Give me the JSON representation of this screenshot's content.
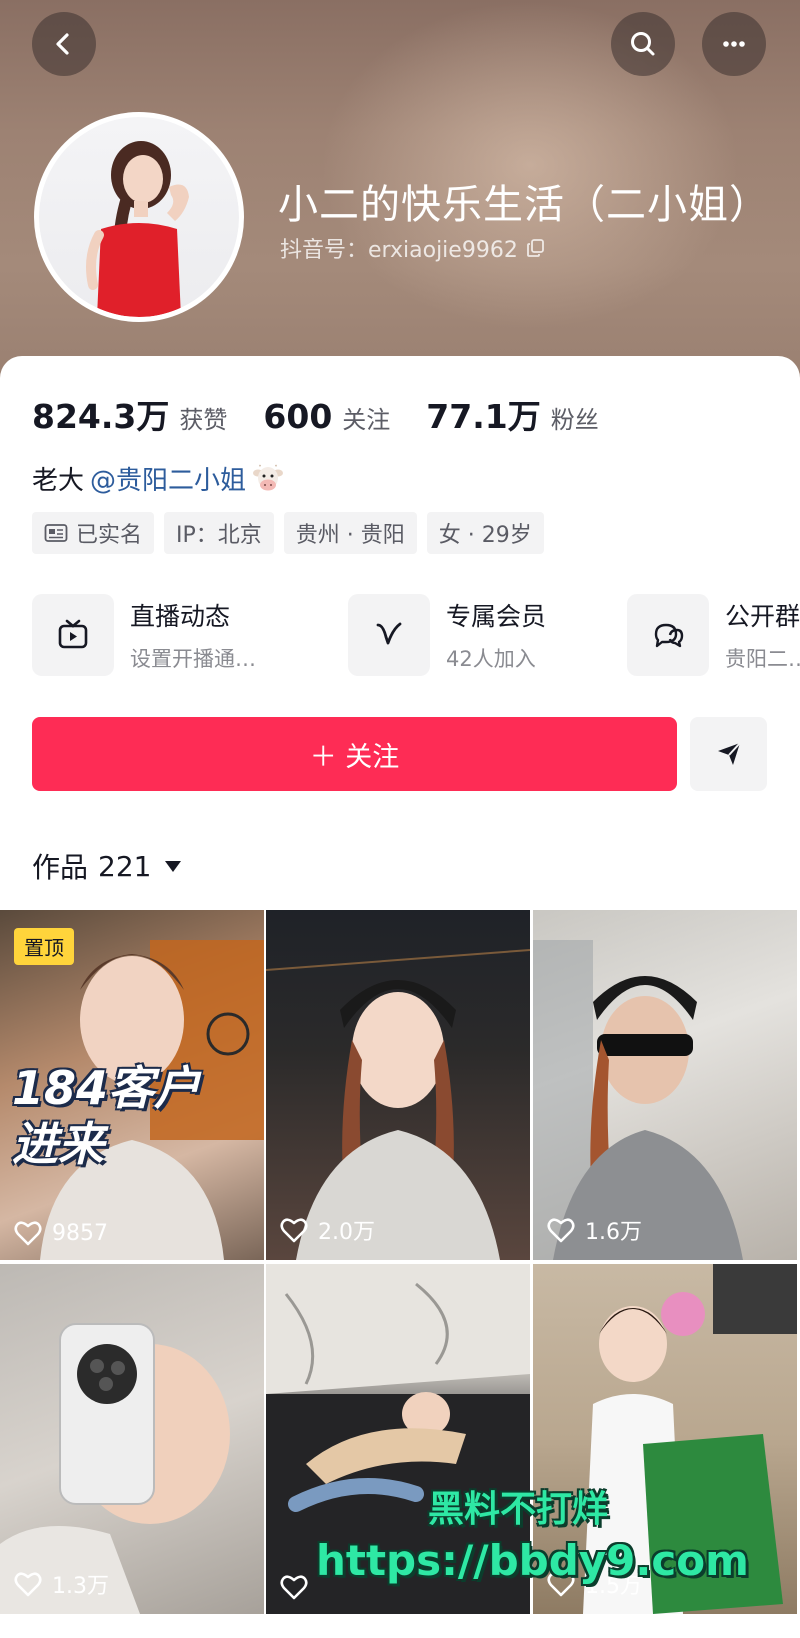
{
  "profile": {
    "name": "小二的快乐生活（二小姐）",
    "douyin_id": "抖音号：erxiaojie9962"
  },
  "stats": [
    {
      "value": "824.3万",
      "label": "获赞"
    },
    {
      "value": "600",
      "label": "关注"
    },
    {
      "value": "77.1万",
      "label": "粉丝"
    }
  ],
  "bio": {
    "prefix": "老大",
    "mention": "@贵阳二小姐"
  },
  "tags": [
    "已实名",
    "IP：北京",
    "贵州 · 贵阳",
    "女 · 29岁"
  ],
  "features": [
    {
      "title": "直播动态",
      "subtitle": "设置开播通…",
      "icon": "tv-icon"
    },
    {
      "title": "专属会员",
      "subtitle": "42人加入",
      "icon": "v-icon"
    },
    {
      "title": "公开群",
      "subtitle": "贵阳二…",
      "icon": "chat-icon"
    }
  ],
  "actions": {
    "follow_label": "＋ 关注"
  },
  "works": {
    "label": "作品",
    "count": "221"
  },
  "videos": [
    {
      "likes": "9857",
      "pinned": "置顶",
      "overlay_line1": "184客户",
      "overlay_line2": "进来"
    },
    {
      "likes": "2.0万"
    },
    {
      "likes": "1.6万"
    },
    {
      "likes": "1.3万"
    },
    {
      "likes": ""
    },
    {
      "likes": "1.5万"
    }
  ],
  "watermark": {
    "line1": "黑料不打烊",
    "line2": "https://bbdy9.com"
  },
  "colors": {
    "accent": "#fe2c55",
    "mention": "#2d5c9c",
    "pin_badge": "#ffd43b",
    "watermark": "#2ee8a4"
  }
}
